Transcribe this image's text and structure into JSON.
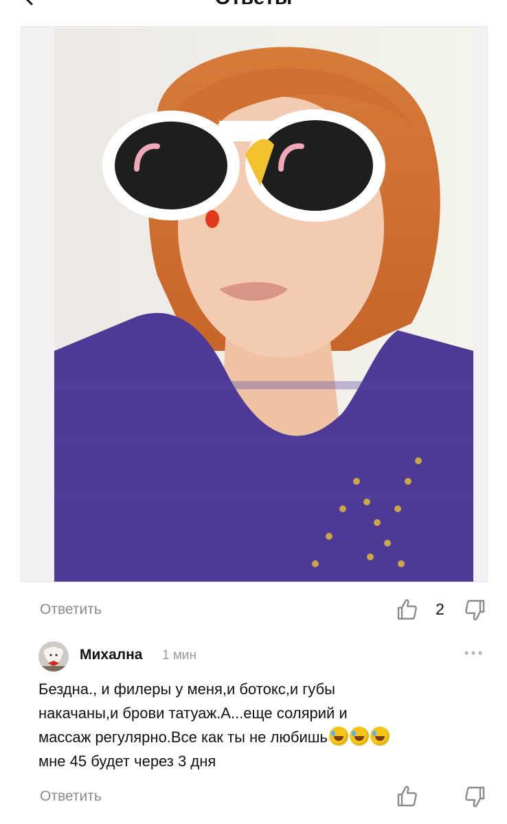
{
  "header": {
    "title": "Ответы"
  },
  "post": {
    "reply_label": "Ответить",
    "likes": "2"
  },
  "comment": {
    "author": "Михална",
    "time": "1 мин",
    "lines": [
      "Бездна., и филеры у меня,и ботокс,и губы",
      "накачаны,и брови татуаж.А...еще солярий и",
      "массаж регулярно.Все как ты не любишь",
      "мне 45 будет через 3 дня"
    ],
    "emoji_count": 3,
    "reply_label": "Ответить"
  },
  "icons": {
    "back": "chevron-left-icon",
    "like": "thumb-up-icon",
    "dislike": "thumb-down-icon",
    "more": "more-dots-icon",
    "emoji": "rolling-laughing-emoji"
  },
  "colors": {
    "muted_text": "#8a8a8e",
    "card_bg": "#f1f1f3"
  }
}
